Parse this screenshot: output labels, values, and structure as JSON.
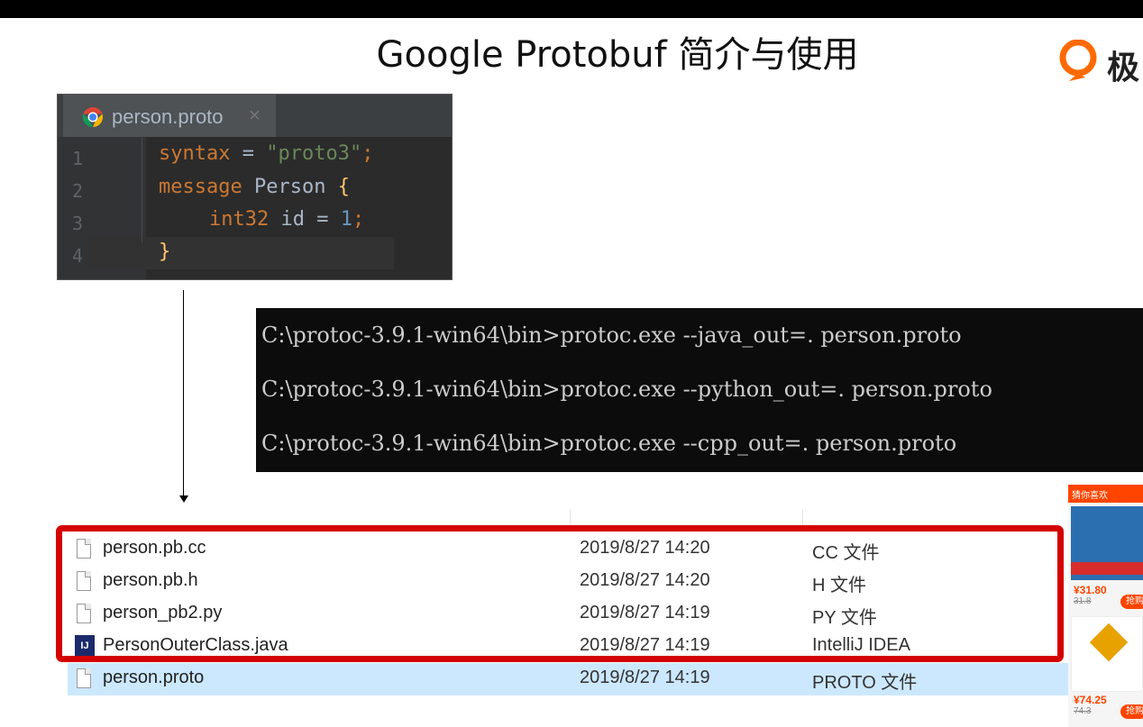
{
  "slide": {
    "title": "Google Protobuf 简介与使用",
    "logo_text": "极"
  },
  "editor": {
    "tab_label": "person.proto",
    "close_glyph": "×",
    "line_numbers": [
      "1",
      "2",
      "3",
      "4"
    ],
    "code": {
      "l1_kw": "syntax",
      "l1_eq": " = ",
      "l1_str": "\"proto3\"",
      "l1_end": ";",
      "l2_kw": "message",
      "l2_name": " Person ",
      "l2_brace": "{",
      "l3_type": "int32",
      "l3_field": " id = ",
      "l3_num": "1",
      "l3_end": ";",
      "l4_brace": "}"
    }
  },
  "console": {
    "lines": [
      "C:\\protoc-3.9.1-win64\\bin>protoc.exe --java_out=. person.proto",
      "C:\\protoc-3.9.1-win64\\bin>protoc.exe --python_out=. person.proto",
      "C:\\protoc-3.9.1-win64\\bin>protoc.exe --cpp_out=. person.proto"
    ]
  },
  "files": [
    {
      "name": "person.pb.cc",
      "date": "2019/8/27 14:20",
      "type": "CC 文件",
      "icon": "file-icon"
    },
    {
      "name": "person.pb.h",
      "date": "2019/8/27 14:20",
      "type": "H 文件",
      "icon": "file-icon"
    },
    {
      "name": "person_pb2.py",
      "date": "2019/8/27 14:19",
      "type": "PY 文件",
      "icon": "file-icon"
    },
    {
      "name": "PersonOuterClass.java",
      "date": "2019/8/27 14:19",
      "type": "IntelliJ IDEA",
      "icon": "intellij-icon"
    },
    {
      "name": "person.proto",
      "date": "2019/8/27 14:19",
      "type": "PROTO 文件",
      "icon": "file-icon",
      "selected": true
    }
  ],
  "ad": {
    "header": "猜你喜欢",
    "items": [
      {
        "price": "¥31.80",
        "old_price": "31.8",
        "button": "抢购"
      },
      {
        "price": "¥74.25",
        "old_price": "74.3",
        "button": "抢购"
      }
    ]
  },
  "colors": {
    "highlight_box": "#d40000",
    "selected_row": "#cce8ff",
    "editor_bg": "#2b2b2b",
    "console_bg": "#0c0c0c"
  }
}
